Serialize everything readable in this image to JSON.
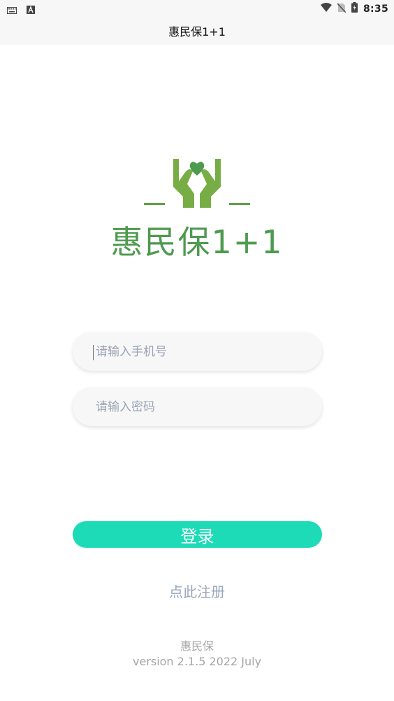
{
  "status_bar": {
    "time": "8:35",
    "icons": [
      "keyboard-icon",
      "a-badge-icon",
      "wifi-icon",
      "no-sim-icon",
      "battery-icon"
    ]
  },
  "title_bar": {
    "title": "惠民保1+1"
  },
  "logo": {
    "text": "惠民保1+1",
    "color": "#4e9a4f",
    "icon": "hands-heart-icon"
  },
  "form": {
    "phone_placeholder": "请输入手机号",
    "password_placeholder": "请输入密码",
    "login_label": "登录",
    "accent_color": "#1ddbb6"
  },
  "register": {
    "label": "点此注册"
  },
  "footer": {
    "name": "惠民保",
    "version": "version 2.1.5 2022 July"
  }
}
